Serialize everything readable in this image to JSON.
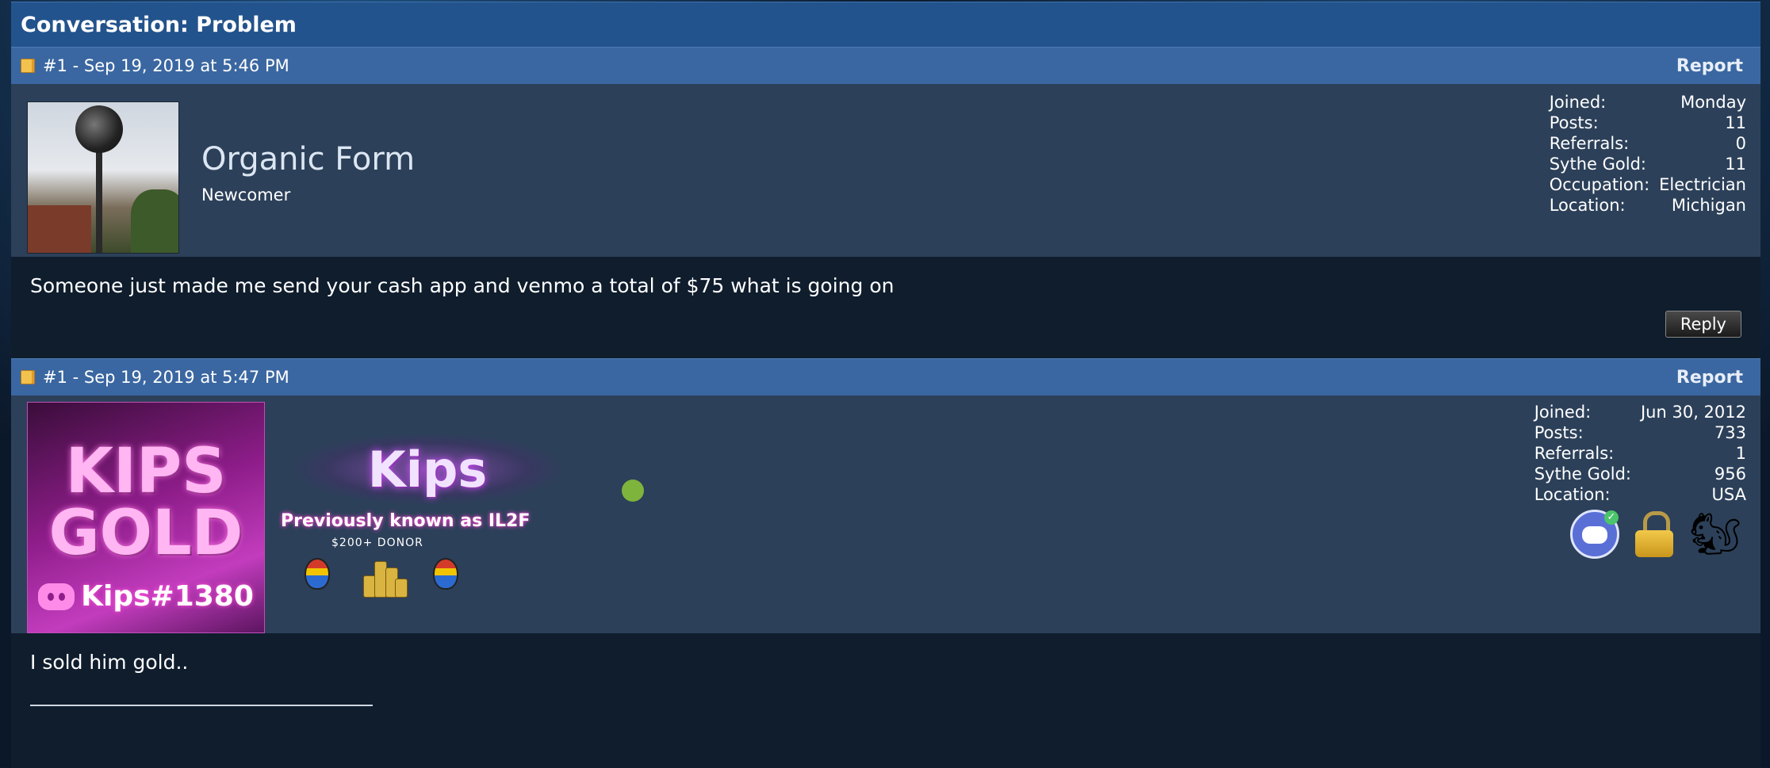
{
  "conversation": {
    "title": "Conversation: Problem"
  },
  "posts": [
    {
      "header": {
        "label": "#1 - Sep 19, 2019 at 5:46 PM",
        "report": "Report"
      },
      "author": {
        "name": "Organic Form",
        "title": "Newcomer",
        "stats": [
          {
            "key": "Joined:",
            "value": "Monday"
          },
          {
            "key": "Posts:",
            "value": "11"
          },
          {
            "key": "Referrals:",
            "value": "0"
          },
          {
            "key": "Sythe Gold:",
            "value": "11"
          },
          {
            "key": "Occupation:",
            "value": "Electrician"
          },
          {
            "key": "Location:",
            "value": "Michigan"
          }
        ]
      },
      "message": "Someone just made me send your cash app and venmo a total of $75 what is going on",
      "reply_label": "Reply"
    },
    {
      "header": {
        "label": "#1 - Sep 19, 2019 at 5:47 PM",
        "report": "Report"
      },
      "author": {
        "avatar_text_top": "KIPS",
        "avatar_text_bottom": "GOLD",
        "avatar_tag": "Kips#1380",
        "banner": "Kips",
        "previously_known": "Previously known as IL2F",
        "donor": "$200+ DONOR",
        "online_color": "#7eb43c",
        "stats": [
          {
            "key": "Joined:",
            "value": "Jun 30, 2012"
          },
          {
            "key": "Posts:",
            "value": "733"
          },
          {
            "key": "Referrals:",
            "value": "1"
          },
          {
            "key": "Sythe Gold:",
            "value": "956"
          },
          {
            "key": "Location:",
            "value": "USA"
          }
        ],
        "badges": [
          "discord-verified-icon",
          "lock-icon",
          "squirrel-icon"
        ],
        "trophies": [
          "easter-egg-icon",
          "gold-coins-icon",
          "easter-egg-icon"
        ]
      },
      "message": "I sold him gold.."
    }
  ]
}
